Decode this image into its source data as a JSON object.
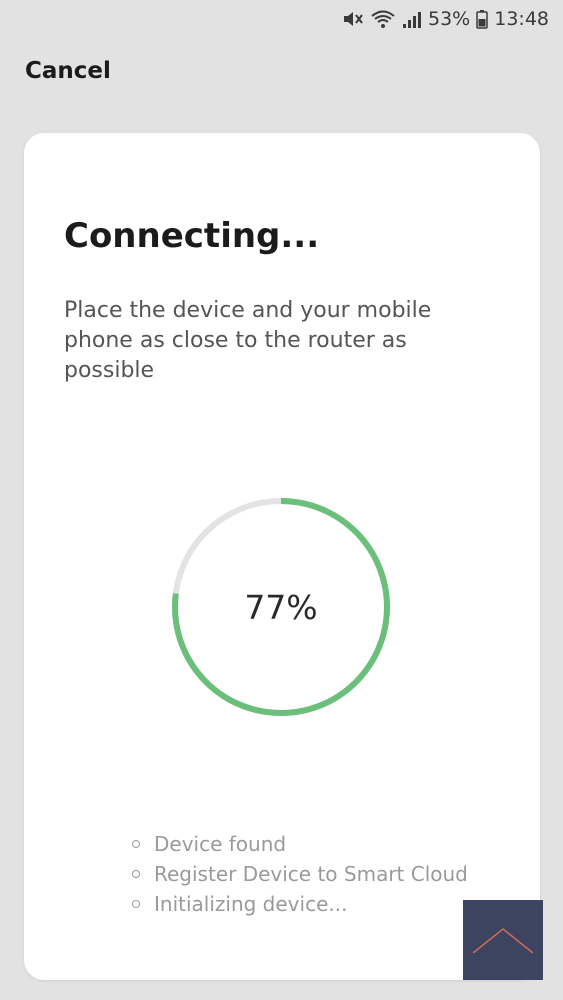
{
  "status_bar": {
    "battery": "53%",
    "time": "13:48",
    "icons": [
      "mute-icon",
      "wifi-icon",
      "signal-icon",
      "battery-icon"
    ]
  },
  "header": {
    "cancel_label": "Cancel"
  },
  "card": {
    "title": "Connecting...",
    "description": "Place the device and your mobile phone as close to the router as possible",
    "progress": {
      "value": 77,
      "label": "77%",
      "color": "#6abf7b",
      "track_color": "#e3e3e3"
    },
    "steps": [
      {
        "label": "Device found"
      },
      {
        "label": "Register Device to Smart Cloud"
      },
      {
        "label": "Initializing device..."
      }
    ]
  },
  "scroll_top": {
    "icon": "chevron-up-icon",
    "background": "#3c4460",
    "icon_color": "#c86a5a"
  }
}
